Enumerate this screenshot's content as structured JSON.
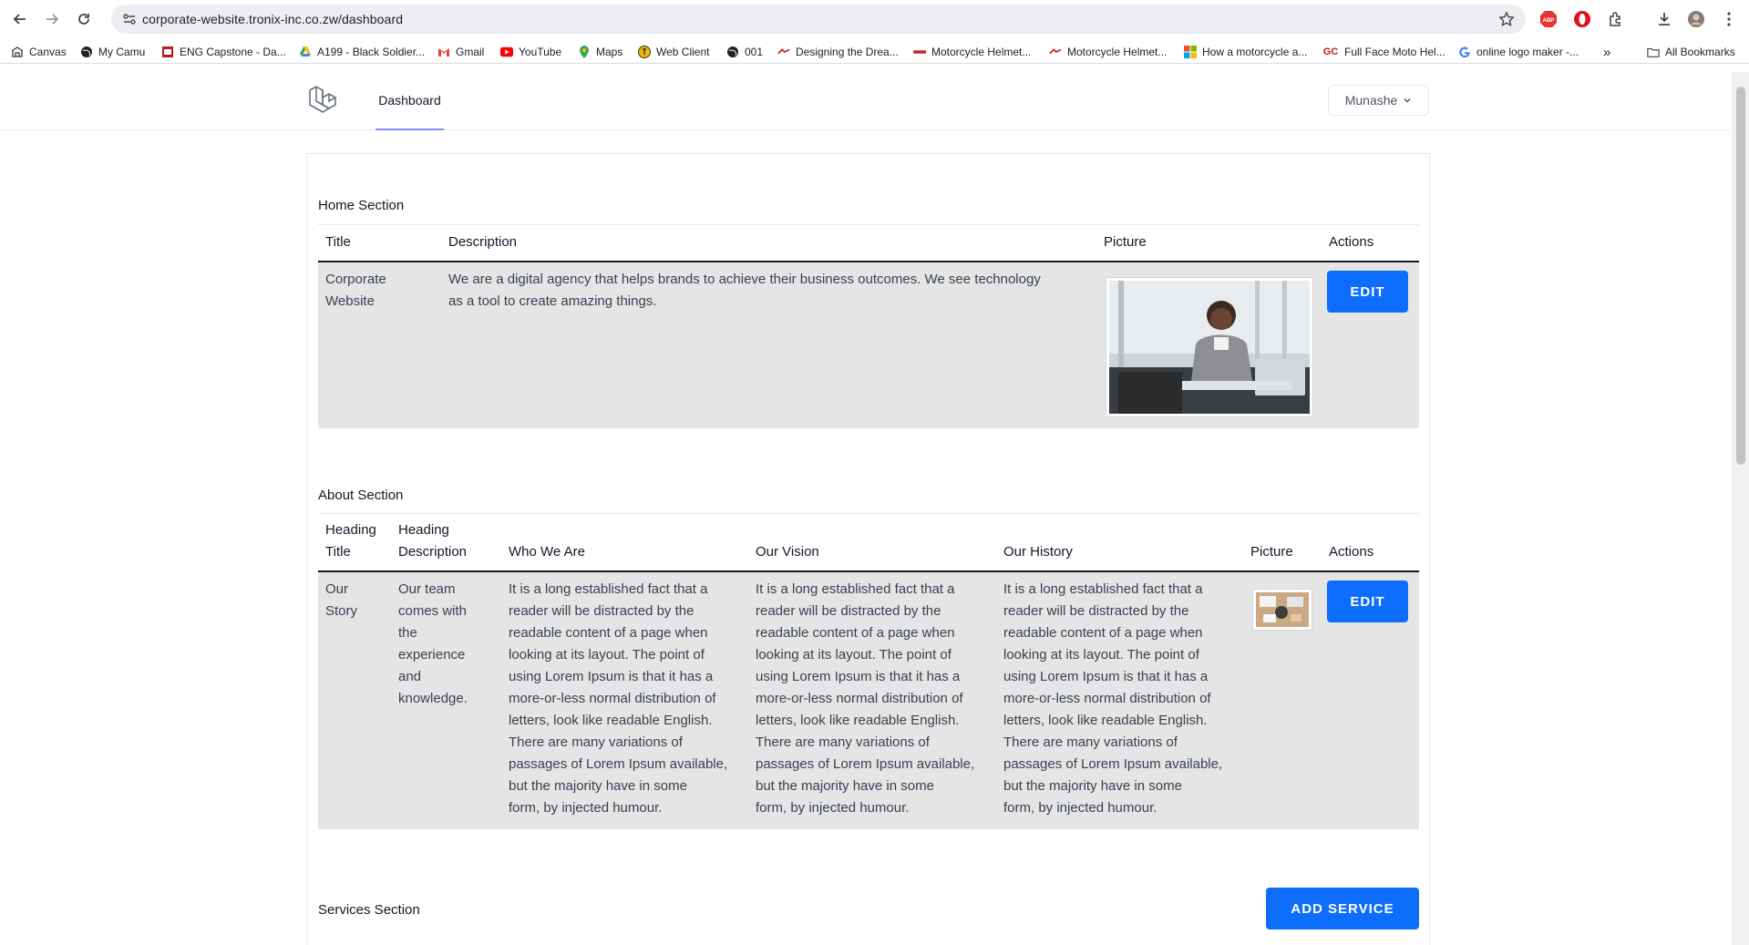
{
  "browser": {
    "url": "corporate-website.tronix-inc.co.zw/dashboard",
    "bookmarks": [
      {
        "label": "Canvas",
        "icon": "canvas-icon"
      },
      {
        "label": "My Camu",
        "icon": "globe-icon"
      },
      {
        "label": "ENG Capstone - Da...",
        "icon": "capstone-icon"
      },
      {
        "label": "A199 - Black Soldier...",
        "icon": "drive-icon"
      },
      {
        "label": "Gmail",
        "icon": "gmail-icon"
      },
      {
        "label": "YouTube",
        "icon": "youtube-icon"
      },
      {
        "label": "Maps",
        "icon": "maps-icon"
      },
      {
        "label": "Web Client",
        "icon": "webclient-icon"
      },
      {
        "label": "001",
        "icon": "globe-icon"
      },
      {
        "label": "Designing the Drea...",
        "icon": "site-icon"
      },
      {
        "label": "Motorcycle Helmet...",
        "icon": "site-icon"
      },
      {
        "label": "Motorcycle Helmet...",
        "icon": "site-icon"
      },
      {
        "label": "How a motorcycle a...",
        "icon": "microsoft-icon"
      },
      {
        "label": "Full Face Moto Hel...",
        "icon": "gc-icon"
      },
      {
        "label": "online logo maker -...",
        "icon": "google-icon"
      }
    ],
    "more_bookmarks": "»",
    "all_bookmarks": "All Bookmarks"
  },
  "nav": {
    "dashboard_label": "Dashboard",
    "user_name": "Munashe"
  },
  "home_section": {
    "title": "Home Section",
    "columns": [
      "Title",
      "Description",
      "Picture",
      "Actions"
    ],
    "row": {
      "title_line1": "Corporate",
      "title_line2": "Website",
      "description_line1": "We are a digital agency that helps brands to achieve their business outcomes. We see technology",
      "description_line2": "as a tool to create amazing things.",
      "action_label": "EDIT"
    }
  },
  "about_section": {
    "title": "About Section",
    "columns": {
      "heading_title_1": "Heading",
      "heading_title_2": "Title",
      "heading_desc_1": "Heading",
      "heading_desc_2": "Description",
      "who": "Who We Are",
      "vision": "Our Vision",
      "history": "Our History",
      "picture": "Picture",
      "actions": "Actions"
    },
    "row": {
      "heading_title": [
        "Our",
        "Story"
      ],
      "heading_description": [
        "Our team",
        "comes with",
        "the",
        "experience",
        "and",
        "knowledge."
      ],
      "lorem_lines": [
        "It is a long established fact that a",
        "reader will be distracted by the",
        "readable content of a page when",
        "looking at its layout. The point of",
        "using Lorem Ipsum is that it has a",
        "more-or-less normal distribution of",
        "letters, look like readable English.",
        "There are many variations of",
        "passages of Lorem Ipsum available,",
        "but the majority have in some",
        "form, by injected humour."
      ],
      "action_label": "EDIT"
    }
  },
  "services_section": {
    "title": "Services Section",
    "add_label": "ADD SERVICE"
  },
  "colors": {
    "primary_button": "#0d6efd",
    "row_background": "#e5e5e5",
    "nav_underline": "#818cf8"
  }
}
